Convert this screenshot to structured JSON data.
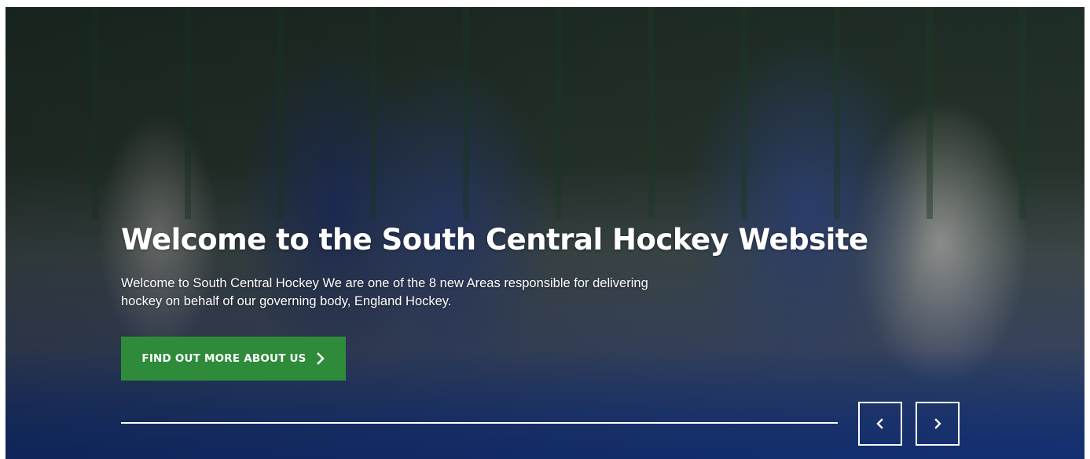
{
  "hero": {
    "title": "Welcome to the South Central Hockey Website",
    "description": "Welcome to South Central Hockey We are one of the 8 new Areas responsible for delivering hockey on behalf of our governing body, England Hockey.",
    "cta_label": "FIND OUT MORE ABOUT US",
    "cta_icon": "chevron-right-icon",
    "background_image": "hockey-players-celebrating-photo"
  },
  "slider": {
    "prev_icon": "chevron-left-icon",
    "next_icon": "chevron-right-icon"
  },
  "colors": {
    "cta_background": "#2e8b3a",
    "text": "#ffffff"
  }
}
